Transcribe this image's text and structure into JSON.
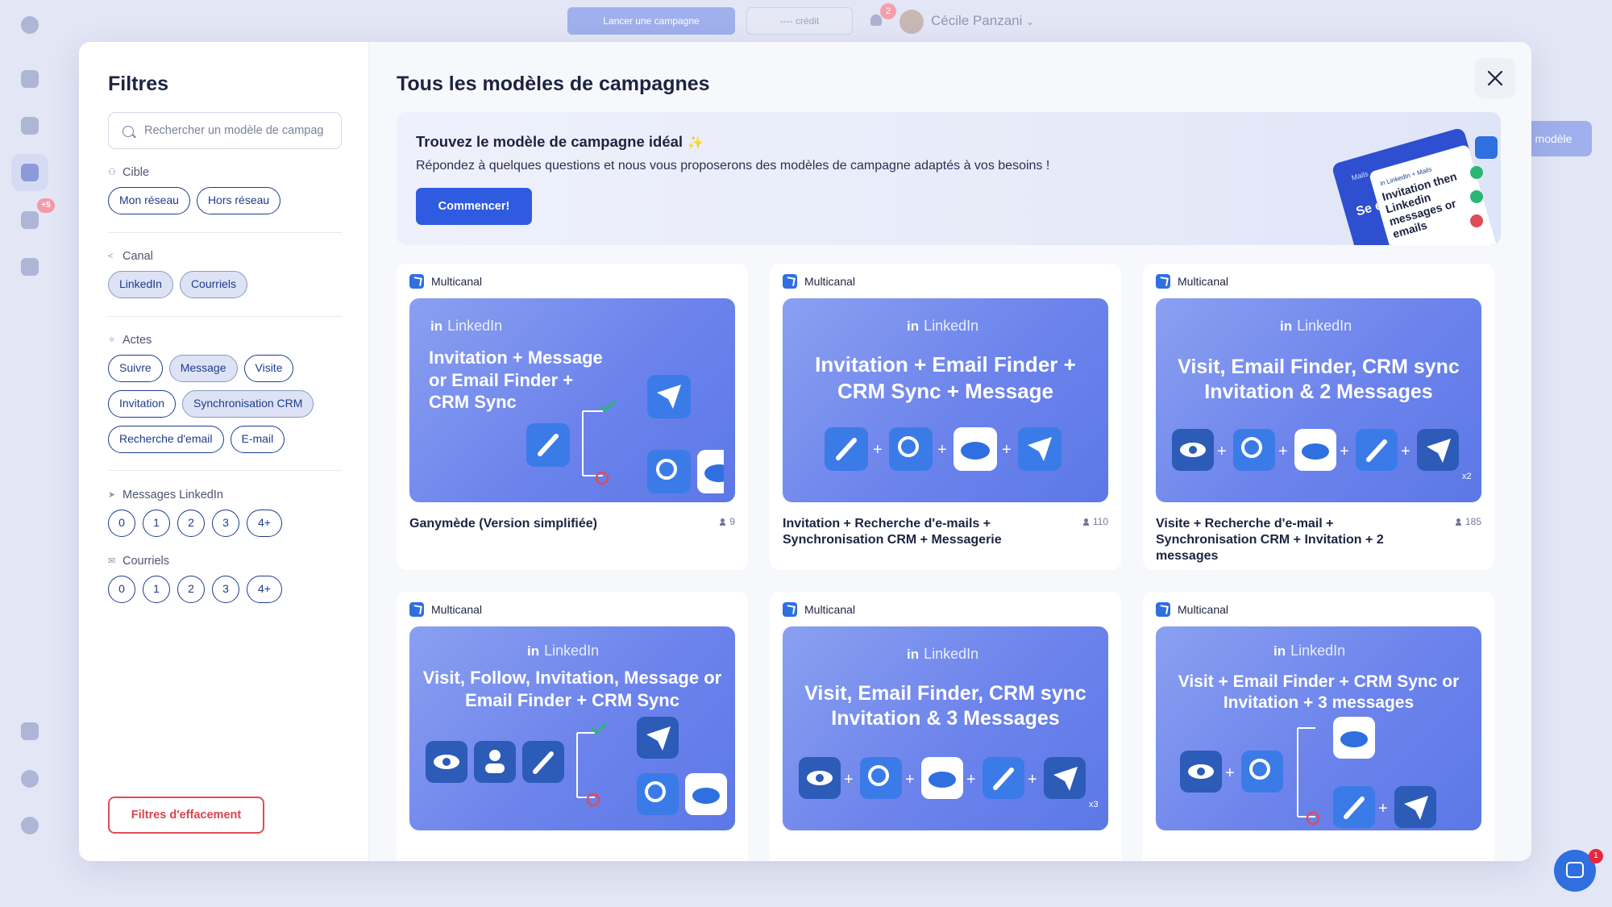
{
  "app": {
    "launch_label": "Lancer une campagne",
    "credit_label": "---- crédit",
    "notif_count": "2",
    "user_name": "Cécile Panzani",
    "sidebar_badge": "+5",
    "right_button": "modèle",
    "chat_badge": "1"
  },
  "modal": {
    "filters": {
      "title": "Filtres",
      "search_placeholder": "Rechercher un modèle de campag",
      "cible": {
        "label": "Cible",
        "options": [
          "Mon réseau",
          "Hors réseau"
        ]
      },
      "canal": {
        "label": "Canal",
        "options": [
          "LinkedIn",
          "Courriels"
        ]
      },
      "actes": {
        "label": "Actes",
        "options": [
          "Suivre",
          "Message",
          "Visite",
          "Invitation",
          "Synchronisation CRM",
          "Recherche d'email",
          "E-mail"
        ]
      },
      "messages_linkedin": {
        "label": "Messages LinkedIn",
        "options": [
          "0",
          "1",
          "2",
          "3",
          "4+"
        ]
      },
      "courriels": {
        "label": "Courriels",
        "options": [
          "0",
          "1",
          "2",
          "3",
          "4+"
        ]
      },
      "clear_label": "Filtres d'effacement"
    },
    "main": {
      "title": "Tous les modèles de campagnes",
      "banner": {
        "title": "Trouvez le modèle de campagne idéal",
        "text": "Répondez à quelques questions et nous vous proposerons des modèles de campagne adaptés à vos besoins !",
        "button": "Commencer!",
        "art_tag": "Mails",
        "art_tag2": "in LinkedIn + Mails",
        "art_text": "Invitation then Linkedin messages or emails",
        "art_side": "Se en"
      },
      "cards": [
        {
          "tag": "Multicanal",
          "brand": "LinkedIn",
          "thumb_title": "Invitation + Message or Email Finder + CRM Sync",
          "name": "Ganymède (Version simplifiée)",
          "count": "9"
        },
        {
          "tag": "Multicanal",
          "brand": "LinkedIn",
          "thumb_title": "Invitation + Email Finder + CRM Sync + Message",
          "name": "Invitation + Recherche d'e-mails + Synchronisation CRM + Messagerie",
          "count": "110"
        },
        {
          "tag": "Multicanal",
          "brand": "LinkedIn",
          "thumb_title": "Visit, Email Finder, CRM sync Invitation & 2 Messages",
          "name": "Visite + Recherche d'e-mail + Synchronisation CRM + Invitation + 2 messages",
          "count": "185",
          "mult": "x2"
        },
        {
          "tag": "Multicanal",
          "brand": "LinkedIn",
          "thumb_title": "Visit, Follow, Invitation, Message or Email Finder + CRM Sync"
        },
        {
          "tag": "Multicanal",
          "brand": "LinkedIn",
          "thumb_title": "Visit, Email Finder, CRM sync Invitation & 3 Messages",
          "mult": "x3"
        },
        {
          "tag": "Multicanal",
          "brand": "LinkedIn",
          "thumb_title": "Visit + Email Finder + CRM Sync or Invitation + 3 messages"
        }
      ]
    }
  },
  "colors": {
    "accent": "#2f5be0",
    "thumb": "#6c83ec",
    "chip": "#1c3c8c",
    "danger": "#e04b58"
  }
}
